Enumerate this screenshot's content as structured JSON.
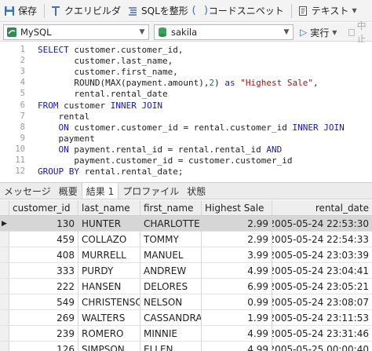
{
  "toolbar": {
    "save_label": "保存",
    "query_builder_label": "クエリビルダ",
    "beautify_label": "SQLを整形",
    "snippet_label": "コードスニペット",
    "text_label": "テキスト"
  },
  "selectors": {
    "connection": "MySQL",
    "database": "sakila",
    "run_label": "実行",
    "stop_label": "中止"
  },
  "editor": {
    "line_numbers": [
      "1",
      "2",
      "3",
      "4",
      "5",
      "6",
      "7",
      "8",
      "9",
      "10",
      "11",
      "12"
    ],
    "lines": [
      [
        {
          "t": "kw",
          "v": "SELECT"
        },
        {
          "t": "plain",
          "v": " customer.customer_id,"
        }
      ],
      [
        {
          "t": "plain",
          "v": "       customer.last_name,"
        }
      ],
      [
        {
          "t": "plain",
          "v": "       customer.first_name,"
        }
      ],
      [
        {
          "t": "plain",
          "v": "       ROUND(MAX(payment.amount),"
        },
        {
          "t": "num",
          "v": "2"
        },
        {
          "t": "plain",
          "v": ") "
        },
        {
          "t": "kw",
          "v": "as"
        },
        {
          "t": "plain",
          "v": " "
        },
        {
          "t": "str",
          "v": "\"Highest Sale\""
        },
        {
          "t": "plain",
          "v": ","
        }
      ],
      [
        {
          "t": "plain",
          "v": "       rental.rental_date"
        }
      ],
      [
        {
          "t": "kw",
          "v": "FROM"
        },
        {
          "t": "plain",
          "v": " customer "
        },
        {
          "t": "kw",
          "v": "INNER JOIN"
        }
      ],
      [
        {
          "t": "plain",
          "v": "    rental"
        }
      ],
      [
        {
          "t": "plain",
          "v": "    "
        },
        {
          "t": "kw",
          "v": "ON"
        },
        {
          "t": "plain",
          "v": " customer.customer_id = rental.customer_id "
        },
        {
          "t": "kw",
          "v": "INNER JOIN"
        }
      ],
      [
        {
          "t": "plain",
          "v": "    payment"
        }
      ],
      [
        {
          "t": "plain",
          "v": "    "
        },
        {
          "t": "kw",
          "v": "ON"
        },
        {
          "t": "plain",
          "v": " payment.rental_id = rental.rental_id "
        },
        {
          "t": "kw",
          "v": "AND"
        }
      ],
      [
        {
          "t": "plain",
          "v": "       payment.customer_id = customer.customer_id"
        }
      ],
      [
        {
          "t": "kw",
          "v": "GROUP BY"
        },
        {
          "t": "plain",
          "v": " rental.rental_date;"
        }
      ]
    ]
  },
  "tabs": [
    {
      "label": "メッセージ",
      "active": false
    },
    {
      "label": "概要",
      "active": false
    },
    {
      "label": "結果 1",
      "active": true
    },
    {
      "label": "プロファイル",
      "active": false
    },
    {
      "label": "状態",
      "active": false
    }
  ],
  "results": {
    "columns": [
      "customer_id",
      "last_name",
      "first_name",
      "Highest Sale",
      "rental_date"
    ],
    "rows": [
      [
        "130",
        "HUNTER",
        "CHARLOTTE",
        "2.99",
        "2005-05-24 22:53:30"
      ],
      [
        "459",
        "COLLAZO",
        "TOMMY",
        "2.99",
        "2005-05-24 22:54:33"
      ],
      [
        "408",
        "MURRELL",
        "MANUEL",
        "3.99",
        "2005-05-24 23:03:39"
      ],
      [
        "333",
        "PURDY",
        "ANDREW",
        "4.99",
        "2005-05-24 23:04:41"
      ],
      [
        "222",
        "HANSEN",
        "DELORES",
        "6.99",
        "2005-05-24 23:05:21"
      ],
      [
        "549",
        "CHRISTENSO",
        "NELSON",
        "0.99",
        "2005-05-24 23:08:07"
      ],
      [
        "269",
        "WALTERS",
        "CASSANDRA",
        "1.99",
        "2005-05-24 23:11:53"
      ],
      [
        "239",
        "ROMERO",
        "MINNIE",
        "4.99",
        "2005-05-24 23:31:46"
      ],
      [
        "126",
        "SIMPSON",
        "ELLEN",
        "4.99",
        "2005-05-25 00:00:40"
      ]
    ],
    "selected_row": 0
  },
  "colors": {
    "keyword": "#1a1aa6",
    "string": "#a31515",
    "number": "#098658",
    "selected_row": "#d6d6d6"
  },
  "icons": {
    "save": "floppy-icon",
    "query_builder": "wand-icon",
    "beautify": "format-icon",
    "snippet": "brace-icon",
    "text": "document-icon",
    "connection": "dolphin-icon",
    "database": "database-icon",
    "run": "play-icon",
    "stop": "stop-icon"
  }
}
